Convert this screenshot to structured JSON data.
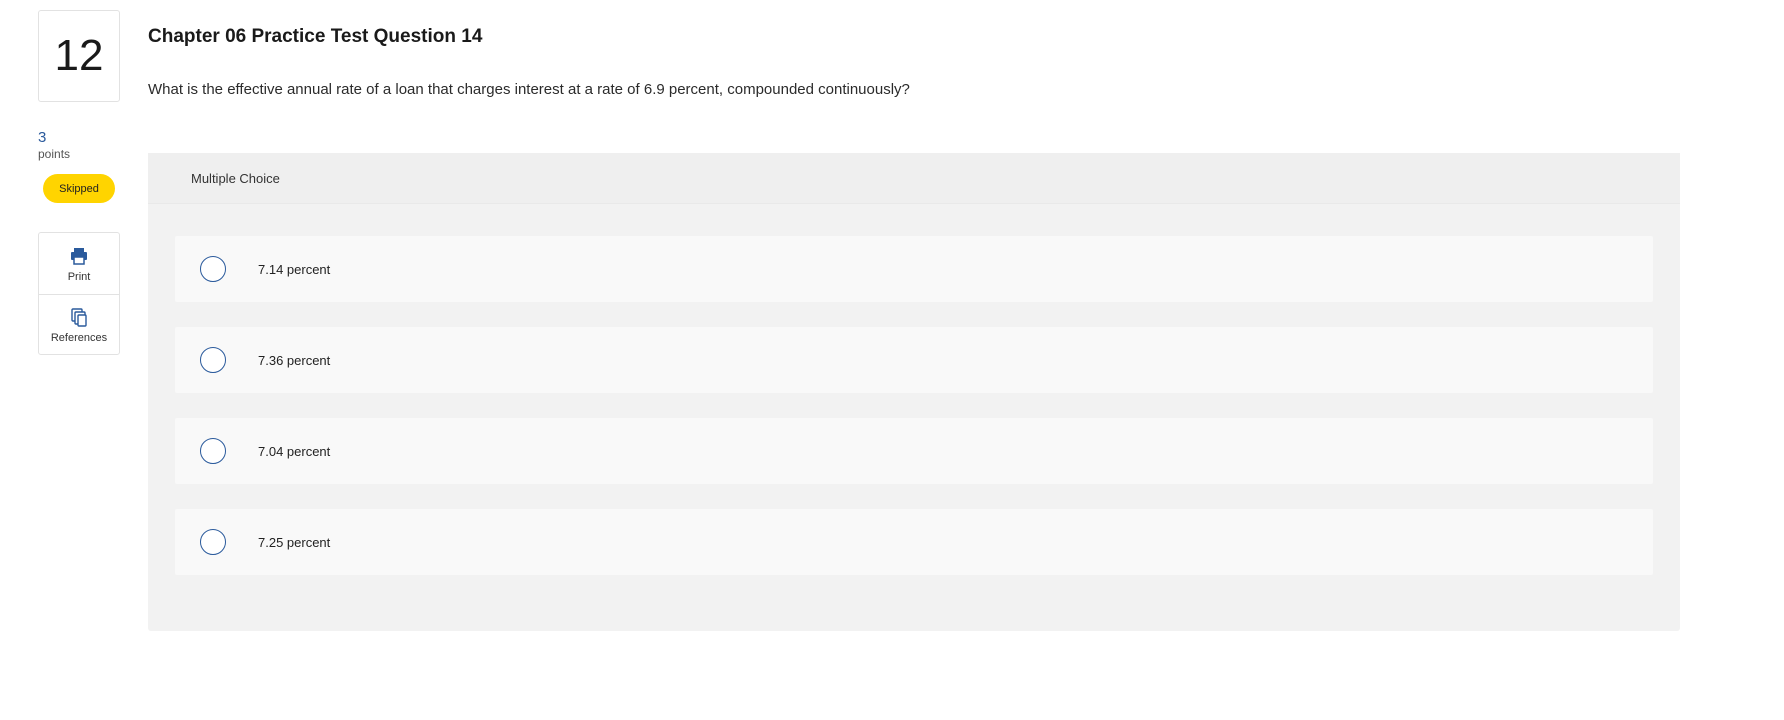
{
  "question": {
    "number": "12",
    "title": "Chapter 06 Practice Test Question 14",
    "text": "What is the effective annual rate of a loan that charges interest at a rate of 6.9 percent, compounded continuously?"
  },
  "points": {
    "value": "3",
    "label": "points"
  },
  "status": {
    "label": "Skipped",
    "color": "#ffd400"
  },
  "tools": [
    {
      "label": "Print",
      "icon": "printer-icon"
    },
    {
      "label": "References",
      "icon": "documents-icon"
    }
  ],
  "multiple_choice": {
    "header": "Multiple Choice",
    "options": [
      {
        "label": "7.14 percent"
      },
      {
        "label": "7.36 percent"
      },
      {
        "label": "7.04 percent"
      },
      {
        "label": "7.25 percent"
      }
    ]
  },
  "colors": {
    "accent": "#2a5a9c",
    "panel": "#f2f2f2"
  }
}
